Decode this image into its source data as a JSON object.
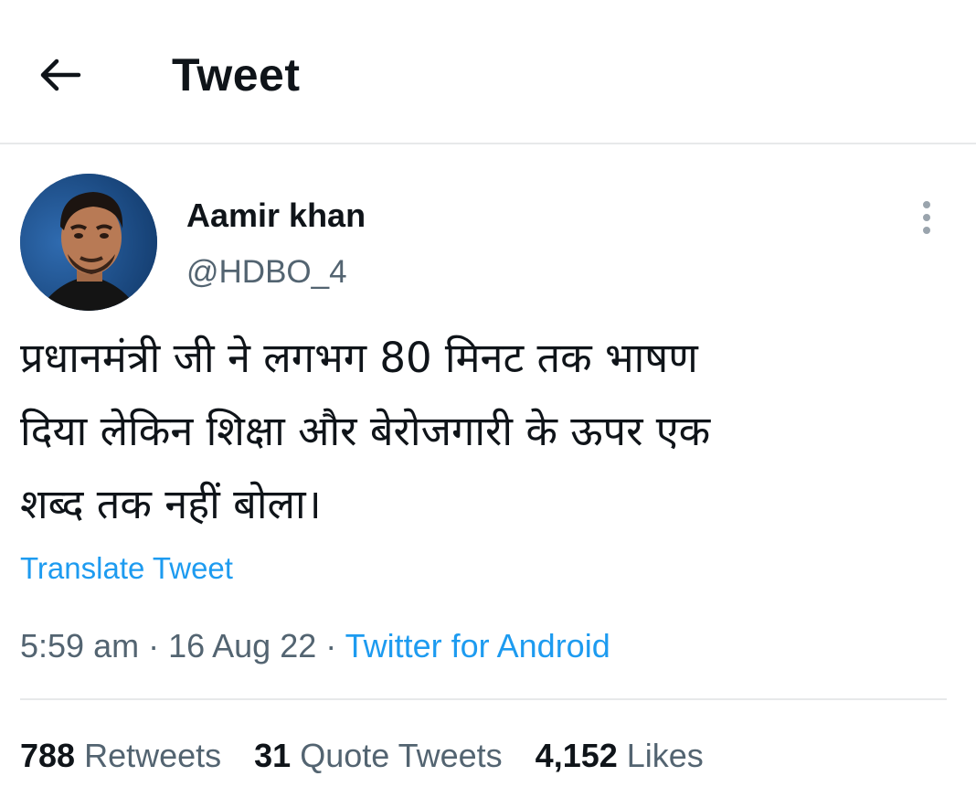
{
  "header": {
    "title": "Tweet",
    "back_icon": "arrow-left-icon"
  },
  "author": {
    "name": "Aamir khan",
    "handle": "@HDBO_4",
    "avatar_icon": "avatar-photo"
  },
  "more_icon": "more-vertical-icon",
  "tweet": {
    "text": "प्रधानमंत्री जी ने लगभग 80 मिनट तक भाषण\nदिया लेकिन शिक्षा और बेरोजगारी के ऊपर एक\nशब्द तक नहीं बोला।",
    "translate_label": "Translate Tweet"
  },
  "meta": {
    "time": "5:59 am",
    "sep1": " · ",
    "date": "16 Aug 22",
    "sep2": " · ",
    "source": "Twitter for Android"
  },
  "stats": {
    "retweets_count": "788",
    "retweets_label": "Retweets",
    "quotes_count": "31",
    "quotes_label": "Quote Tweets",
    "likes_count": "4,152",
    "likes_label": "Likes"
  },
  "colors": {
    "text": "#0f1419",
    "secondary": "#536471",
    "link": "#1d9bf0",
    "divider": "#e7e9ea"
  }
}
